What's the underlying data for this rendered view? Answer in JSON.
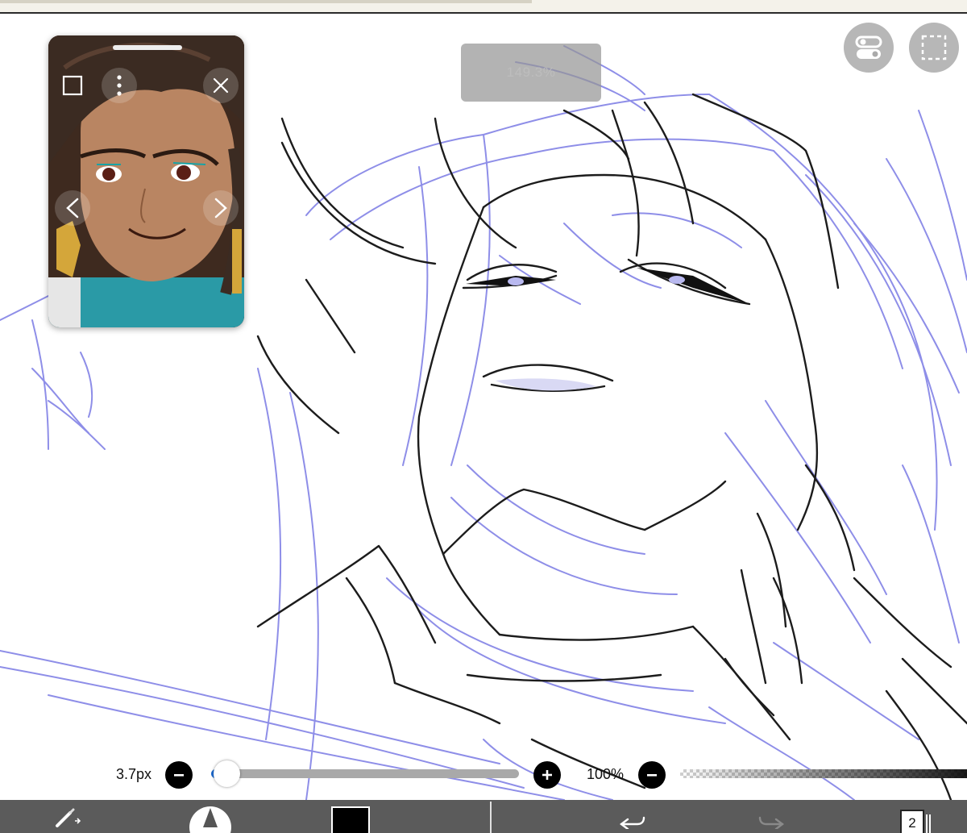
{
  "zoom": {
    "level": "149.3%"
  },
  "brush": {
    "size": "3.7px",
    "size_level_fraction": 0.05,
    "opacity": "100%",
    "opacity_fraction": 1.0
  },
  "color": {
    "current": "#000000",
    "sketch_line": "#8e8ee8",
    "ink_line": "#1c1c1c"
  },
  "layers": {
    "count": "2"
  },
  "icons": {
    "top_right": [
      "toggle-icon",
      "selection-icon"
    ],
    "reference_window": [
      "square-icon",
      "more-icon",
      "close-icon",
      "chevron-left-icon",
      "chevron-right-icon"
    ],
    "size_slider": [
      "minus-icon",
      "plus-icon"
    ],
    "opacity_slider": [
      "minus-icon"
    ],
    "toolbar": [
      "brush-tool-icon",
      "brush-preview-icon",
      "color-swatch",
      "undo-icon",
      "redo-icon",
      "layers-icon"
    ]
  }
}
